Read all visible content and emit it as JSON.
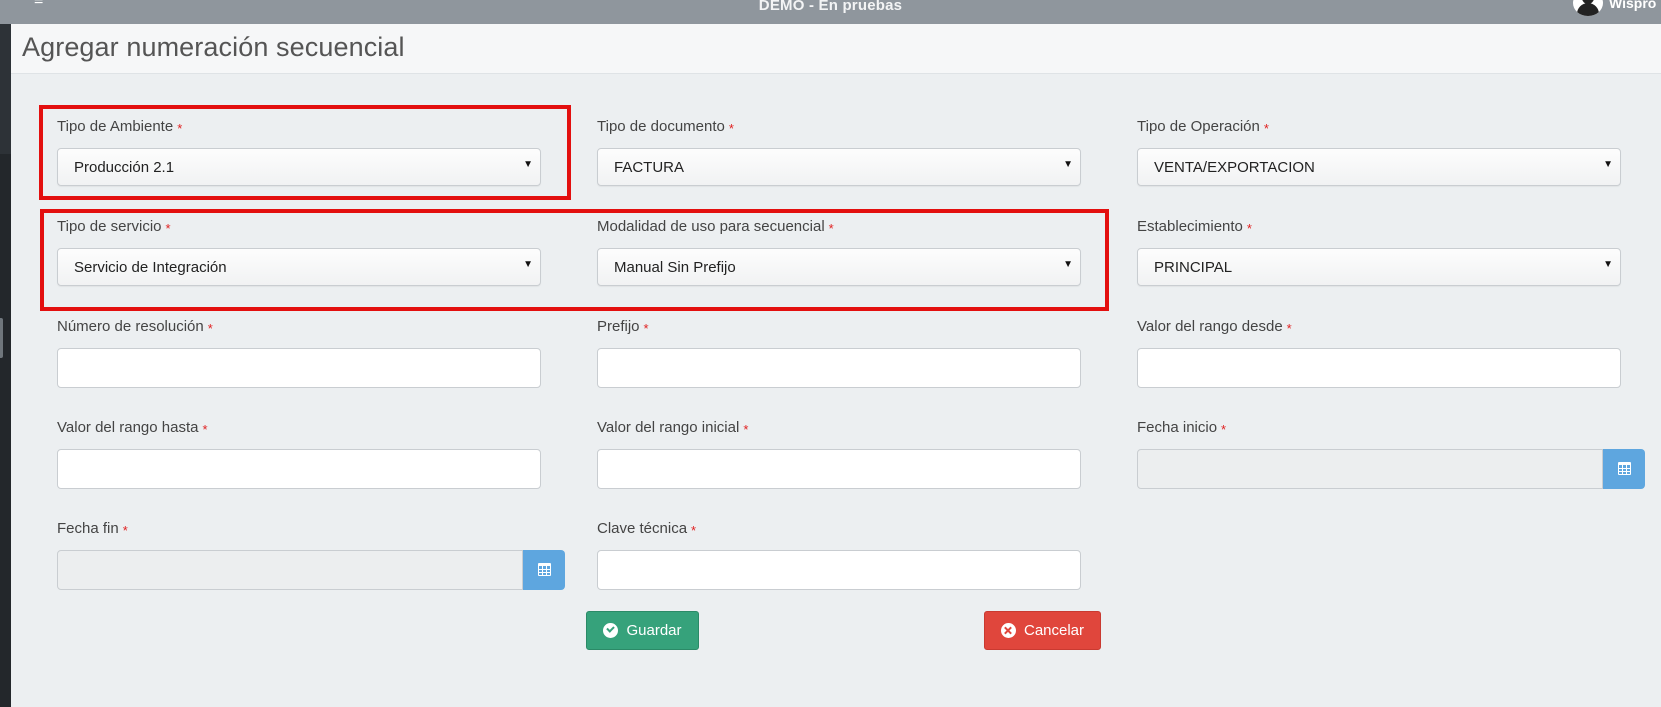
{
  "topbar": {
    "menu_glyph": "≡",
    "env_title": "DEMO - En pruebas",
    "user_name": "Wispro"
  },
  "page": {
    "title": "Agregar numeración secuencial"
  },
  "required_marker": "*",
  "select_caret": "▼",
  "fields": {
    "tipo_ambiente": {
      "label": "Tipo de Ambiente",
      "value": "Producción 2.1"
    },
    "tipo_documento": {
      "label": "Tipo de documento",
      "value": "FACTURA"
    },
    "tipo_operacion": {
      "label": "Tipo de Operación",
      "value": "VENTA/EXPORTACION"
    },
    "tipo_servicio": {
      "label": "Tipo de servicio",
      "value": "Servicio de Integración"
    },
    "modalidad": {
      "label": "Modalidad de uso para secuencial",
      "value": "Manual Sin Prefijo"
    },
    "establecimiento": {
      "label": "Establecimiento",
      "value": "PRINCIPAL"
    },
    "numero_resolucion": {
      "label": "Número de resolución",
      "value": ""
    },
    "prefijo": {
      "label": "Prefijo",
      "value": ""
    },
    "rango_desde": {
      "label": "Valor del rango desde",
      "value": ""
    },
    "rango_hasta": {
      "label": "Valor del rango hasta",
      "value": ""
    },
    "rango_inicial": {
      "label": "Valor del rango inicial",
      "value": ""
    },
    "fecha_inicio": {
      "label": "Fecha inicio",
      "value": ""
    },
    "fecha_fin": {
      "label": "Fecha fin",
      "value": ""
    },
    "clave_tecnica": {
      "label": "Clave técnica",
      "value": ""
    }
  },
  "buttons": {
    "save": "Guardar",
    "cancel": "Cancelar"
  },
  "colors": {
    "topbar": "#8f969d",
    "highlight": "#e30f0f",
    "save": "#36a27b",
    "cancel": "#e0463c",
    "calendar_button": "#5ea6df",
    "required": "#e02020"
  },
  "icons": {
    "menu": "menu-icon",
    "user": "user-avatar-icon",
    "calendar": "calendar-icon",
    "save": "check-circle-icon",
    "cancel": "times-circle-icon"
  }
}
